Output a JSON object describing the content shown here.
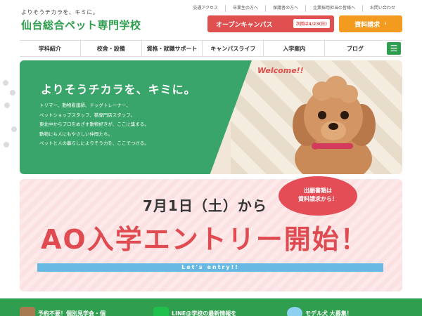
{
  "header": {
    "tagline": "よりそうチカラを、キミに。",
    "logo": "仙台総合ペット専門学校",
    "toplinks": [
      "交通アクセス",
      "卒業生の方へ",
      "保護者の方へ",
      "企業採用担当の皆様へ",
      "お問い合わせ"
    ],
    "open_campus_label": "オープンキャンパス",
    "open_campus_date": "次回は4/23(日)",
    "doc_request_label": "資料請求"
  },
  "nav": {
    "items": [
      "学科紹介",
      "校舎・設備",
      "資格・就職サポート",
      "キャンパスライフ",
      "入学案内",
      "ブログ"
    ],
    "menu_icon": "☰"
  },
  "hero": {
    "title": "よりそうチカラを、キミに。",
    "lines": [
      "トリマー、動物看護師、ドッグトレーナー、",
      "ペットショップスタッフ、猫専門店スタッフ。",
      "東北中からプロをめざす動物好きが、ここに集まる。",
      "動物にも人にもやさしい仲間たち。",
      "ペットと人の暮らしによりそう力を、ここでつける。"
    ],
    "welcome": "Welcome!!"
  },
  "ao": {
    "date": "7月1日（土）から",
    "main": "AO入学エントリー開始！",
    "bar": "Let's entry!!",
    "bubble_line1": "出願書類は",
    "bubble_line2": "資料請求から！"
  },
  "bottom": {
    "card1": "予約不要！個別見学会・個",
    "card2": "LINE@学校の最新情報を",
    "card3": "モデル犬 大募集！"
  },
  "colors": {
    "brand_green": "#2f9e4f",
    "hero_green": "#3aa56a",
    "open_campus_red": "#e05050",
    "doc_orange": "#f39b1f",
    "ao_red": "#e04b52",
    "bar_blue": "#67b8e3"
  }
}
